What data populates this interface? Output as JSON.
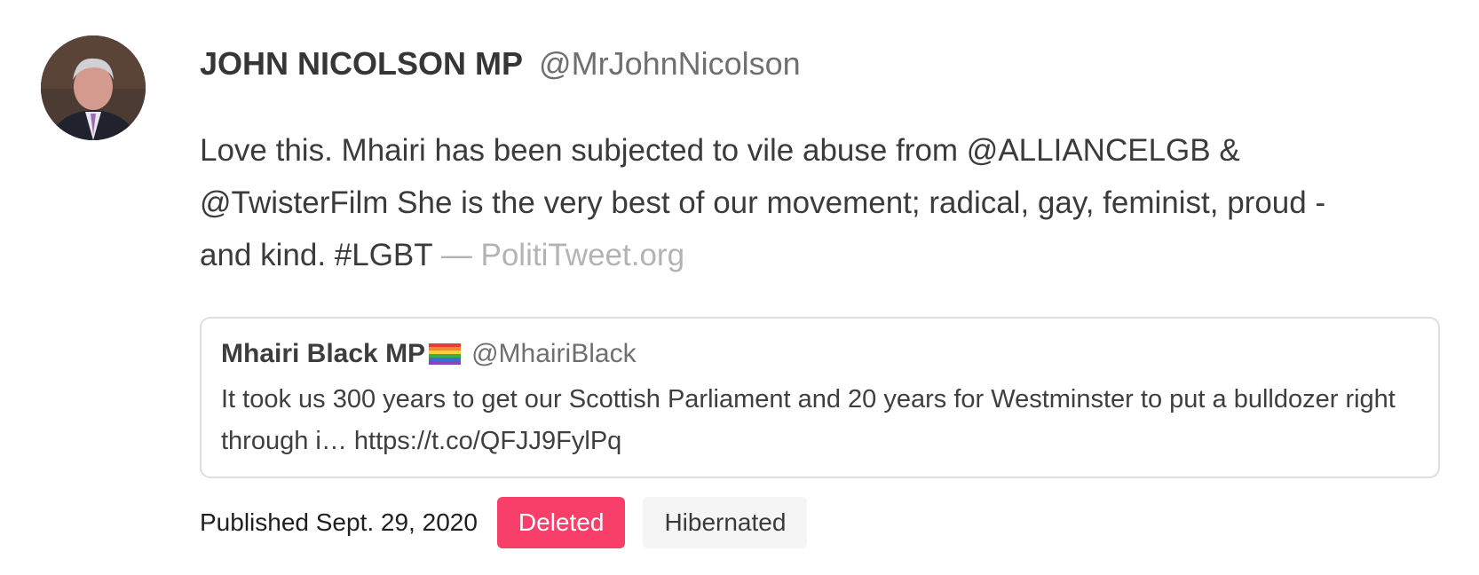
{
  "tweet": {
    "author_name": "JOHN NICOLSON MP",
    "author_handle": "@MrJohnNicolson",
    "text": "Love this. Mhairi has been subjected to vile abuse from @ALLIANCELGB & @TwisterFilm She is the very best of our movement; radical, gay, feminist, proud - and kind. #LGBT",
    "source": "— PolitiTweet.org"
  },
  "quoted_tweet": {
    "author_name": "Mhairi Black MP",
    "flag_icon": "rainbow-flag-icon",
    "author_handle": "@MhairiBlack",
    "text": "It took us 300 years to get our Scottish Parliament and 20 years for Westminster to put a bulldozer right through i… https://t.co/QFJJ9FylPq"
  },
  "footer": {
    "published": "Published Sept. 29, 2020",
    "badges": [
      {
        "label": "Deleted",
        "color": "#f73f6a"
      },
      {
        "label": "Hibernated",
        "color": "#f5f5f5"
      }
    ]
  },
  "colors": {
    "deleted_badge": "#f73f6a",
    "muted_text": "#b3b3b3"
  }
}
